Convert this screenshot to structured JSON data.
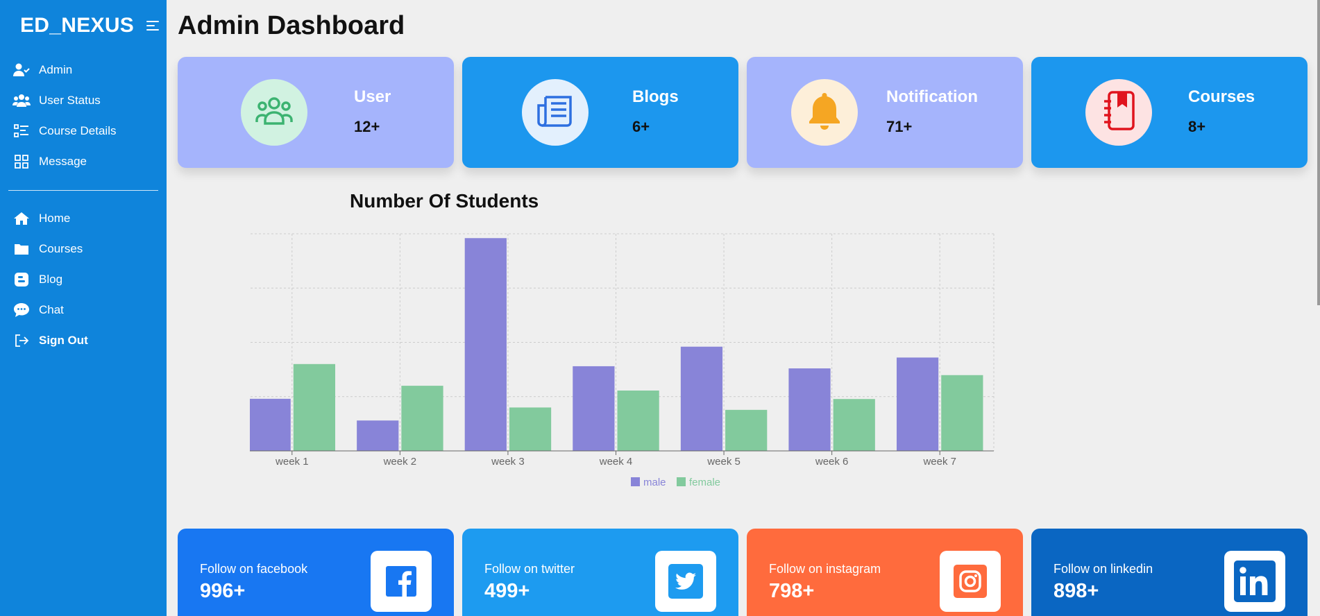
{
  "sidebar": {
    "brand": "ED_NEXUS",
    "items": [
      {
        "label": "Admin",
        "icon": "user-check-icon"
      },
      {
        "label": "User Status",
        "icon": "users-icon"
      },
      {
        "label": "Course Details",
        "icon": "list-icon"
      },
      {
        "label": "Message",
        "icon": "grid-icon"
      }
    ],
    "items2": [
      {
        "label": "Home",
        "icon": "home-icon"
      },
      {
        "label": "Courses",
        "icon": "folder-icon"
      },
      {
        "label": "Blog",
        "icon": "blogger-icon"
      },
      {
        "label": "Chat",
        "icon": "chat-icon"
      },
      {
        "label": "Sign Out",
        "icon": "sign-out-icon"
      }
    ]
  },
  "main": {
    "title": "Admin Dashboard",
    "stats": [
      {
        "label": "User",
        "count": "12+",
        "icon": "users-icon",
        "bg": "#a5b4fc",
        "circle": "#d1f2e1",
        "iconColor": "#3cb371",
        "labelColor": "#ffffff"
      },
      {
        "label": "Blogs",
        "count": "6+",
        "icon": "newspaper-icon",
        "bg": "#1c97ee",
        "circle": "#e3f0fd",
        "iconColor": "#2d6fe0",
        "labelColor": "#ffffff"
      },
      {
        "label": "Notification",
        "count": "71+",
        "icon": "bell-icon",
        "bg": "#a5b4fc",
        "circle": "#fdefd9",
        "iconColor": "#f5a623",
        "labelColor": "#ffffff"
      },
      {
        "label": "Courses",
        "count": "8+",
        "icon": "book-icon",
        "bg": "#1c97ee",
        "circle": "#fde3e3",
        "iconColor": "#e0141e",
        "labelColor": "#ffffff"
      }
    ],
    "social": [
      {
        "label": "Follow on facebook",
        "count": "996+",
        "icon": "facebook-icon",
        "bg": "#1877f2",
        "iconColor": "#1877f2"
      },
      {
        "label": "Follow on twitter",
        "count": "499+",
        "icon": "twitter-icon",
        "bg": "#1d9bf0",
        "iconColor": "#1d9bf0"
      },
      {
        "label": "Follow on instagram",
        "count": "798+",
        "icon": "instagram-icon",
        "bg": "#ff6b3d",
        "iconColor": "#ff6b3d"
      },
      {
        "label": "Follow on linkedin",
        "count": "898+",
        "icon": "linkedin-icon",
        "bg": "#0a66c2",
        "iconColor": "#0a66c2"
      }
    ]
  },
  "chart_data": {
    "type": "bar",
    "title": "Number Of Students",
    "categories": [
      "week 1",
      "week 2",
      "week 3",
      "week 4",
      "week 5",
      "week 6",
      "week 7"
    ],
    "series": [
      {
        "name": "male",
        "values": [
          2400,
          1400,
          9800,
          3900,
          4800,
          3800,
          4300
        ],
        "color": "#8884d8"
      },
      {
        "name": "female",
        "values": [
          4000,
          3000,
          2000,
          2780,
          1890,
          2390,
          3490
        ],
        "color": "#82ca9d"
      }
    ],
    "yticks": [
      0,
      2500,
      5000,
      7500,
      10000
    ],
    "ylim": [
      0,
      10000
    ],
    "grid": true,
    "legend": "bottom-center"
  }
}
